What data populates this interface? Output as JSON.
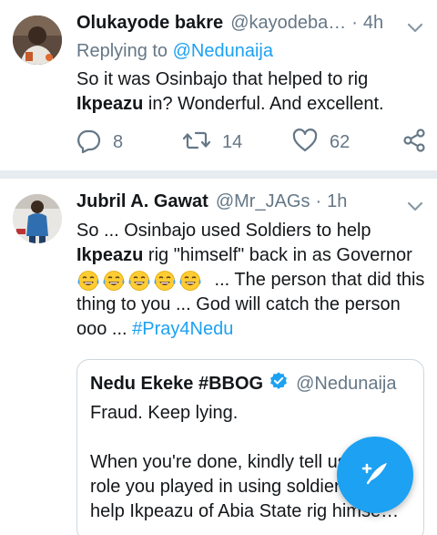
{
  "colors": {
    "accent": "#1da1f2",
    "secondary_text": "#657786",
    "primary_text": "#14171a",
    "divider": "#e6ecf0"
  },
  "tweets": [
    {
      "display_name": "Olukayode bakre",
      "handle": "@kayodeba…",
      "separator": "·",
      "time": "4h",
      "replying_prefix": "Replying to",
      "replying_to": "@Nedunaija",
      "text_line1": "So it was Osinbajo that helped to rig",
      "text_bold": "Ikpeazu",
      "text_rest": " in? Wonderful. And excellent.",
      "reply_count": "8",
      "retweet_count": "14",
      "like_count": "62",
      "icons": [
        "reply-icon",
        "retweet-icon",
        "like-icon",
        "share-icon",
        "chevron-down-icon"
      ]
    },
    {
      "display_name": "Jubril A. Gawat",
      "handle": "@Mr_JAGs",
      "separator": "·",
      "time": "1h",
      "text_line1": "So ... Osinbajo used Soldiers to help",
      "text_bold": "Ikpeazu",
      "text_rest": " rig \"himself\" back in as Governor",
      "emoji_name": "tears-of-joy-emoji",
      "emoji_count": 5,
      "text_after_emoji": " ... The person that did this thing to you ... God will catch the person ooo ... ",
      "hashtag": "#Pray4Nedu",
      "quote": {
        "display_name": "Nedu Ekeke #BBOG",
        "handle": "@Nedunaija",
        "verified_icon": "verified-badge-icon",
        "line1": "Fraud. Keep lying.",
        "line2": "When you're done, kindly tell us the",
        "line3": "role you played in using soldiers to",
        "line4": "help Ikpeazu of Abia State rig himse…"
      }
    }
  ],
  "fab": {
    "icon": "compose-tweet-icon"
  }
}
